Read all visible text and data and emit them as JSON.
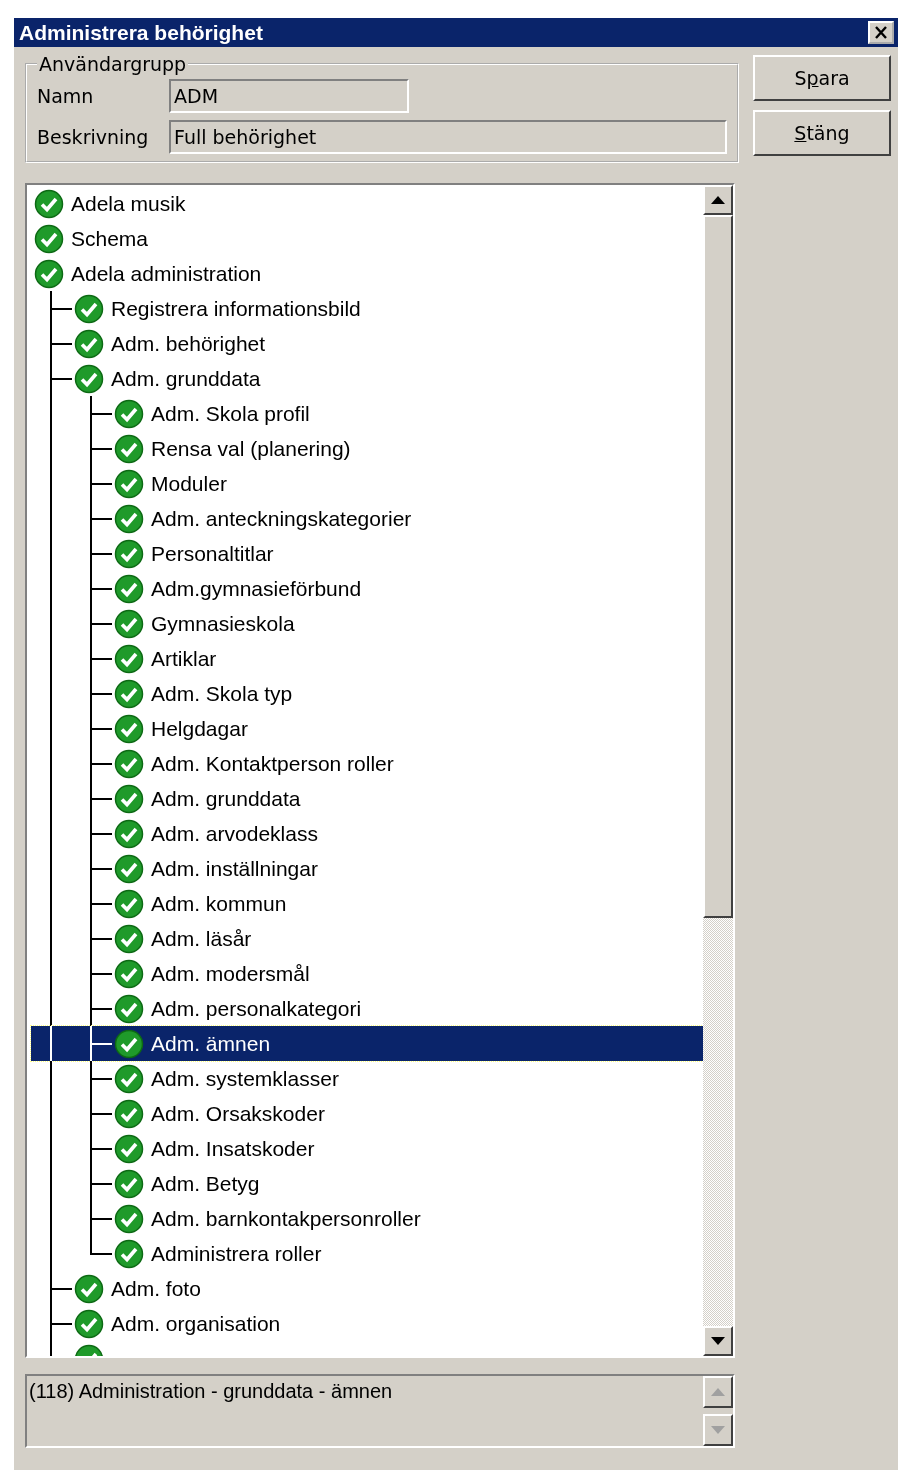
{
  "window": {
    "title": "Administrera behörighet"
  },
  "group": {
    "title": "Användargrupp",
    "fields": [
      {
        "label": "Namn",
        "value": "ADM"
      },
      {
        "label": "Beskrivning",
        "value": "Full behörighet"
      }
    ]
  },
  "buttons": [
    {
      "label_start": "S",
      "access_key": "p",
      "label_end": "ara"
    },
    {
      "access_key": "S",
      "label_end": "täng"
    }
  ],
  "tree": [
    {
      "label": "Adela musik",
      "checked": true,
      "selected": false
    },
    {
      "label": "Schema",
      "checked": true,
      "selected": false
    },
    {
      "label": "Adela administration",
      "checked": true,
      "selected": false,
      "children": [
        {
          "label": "Registrera informationsbild",
          "checked": true,
          "selected": false
        },
        {
          "label": "Adm. behörighet",
          "checked": true,
          "selected": false
        },
        {
          "label": "Adm. grunddata",
          "checked": true,
          "selected": false,
          "children": [
            {
              "label": "Adm. Skola profil",
              "checked": true,
              "selected": false
            },
            {
              "label": "Rensa val (planering)",
              "checked": true,
              "selected": false
            },
            {
              "label": "Moduler",
              "checked": true,
              "selected": false
            },
            {
              "label": "Adm. anteckningskategorier",
              "checked": true,
              "selected": false
            },
            {
              "label": "Personaltitlar",
              "checked": true,
              "selected": false
            },
            {
              "label": "Adm.gymnasieförbund",
              "checked": true,
              "selected": false
            },
            {
              "label": "Gymnasieskola",
              "checked": true,
              "selected": false
            },
            {
              "label": "Artiklar",
              "checked": true,
              "selected": false
            },
            {
              "label": "Adm. Skola typ",
              "checked": true,
              "selected": false
            },
            {
              "label": "Helgdagar",
              "checked": true,
              "selected": false
            },
            {
              "label": "Adm. Kontaktperson roller",
              "checked": true,
              "selected": false
            },
            {
              "label": "Adm. grunddata",
              "checked": true,
              "selected": false
            },
            {
              "label": "Adm. arvodeklass",
              "checked": true,
              "selected": false
            },
            {
              "label": "Adm. inställningar",
              "checked": true,
              "selected": false
            },
            {
              "label": "Adm. kommun",
              "checked": true,
              "selected": false
            },
            {
              "label": "Adm. läsår",
              "checked": true,
              "selected": false
            },
            {
              "label": "Adm. modersmål",
              "checked": true,
              "selected": false
            },
            {
              "label": "Adm. personalkategori",
              "checked": true,
              "selected": false
            },
            {
              "label": "Adm. ämnen",
              "checked": true,
              "selected": true
            },
            {
              "label": "Adm. systemklasser",
              "checked": true,
              "selected": false
            },
            {
              "label": "Adm. Orsakskoder",
              "checked": true,
              "selected": false
            },
            {
              "label": "Adm. Insatskoder",
              "checked": true,
              "selected": false
            },
            {
              "label": "Adm. Betyg",
              "checked": true,
              "selected": false
            },
            {
              "label": "Adm. barnkontakpersonroller",
              "checked": true,
              "selected": false
            },
            {
              "label": "Administrera roller",
              "checked": true,
              "selected": false
            }
          ]
        },
        {
          "label": "Adm. foto",
          "checked": true,
          "selected": false
        },
        {
          "label": "Adm. organisation",
          "checked": true,
          "selected": false
        },
        {
          "checked": true,
          "selected": false
        }
      ]
    }
  ],
  "info": {
    "text": "(118) Administration - grunddata - ämnen"
  }
}
